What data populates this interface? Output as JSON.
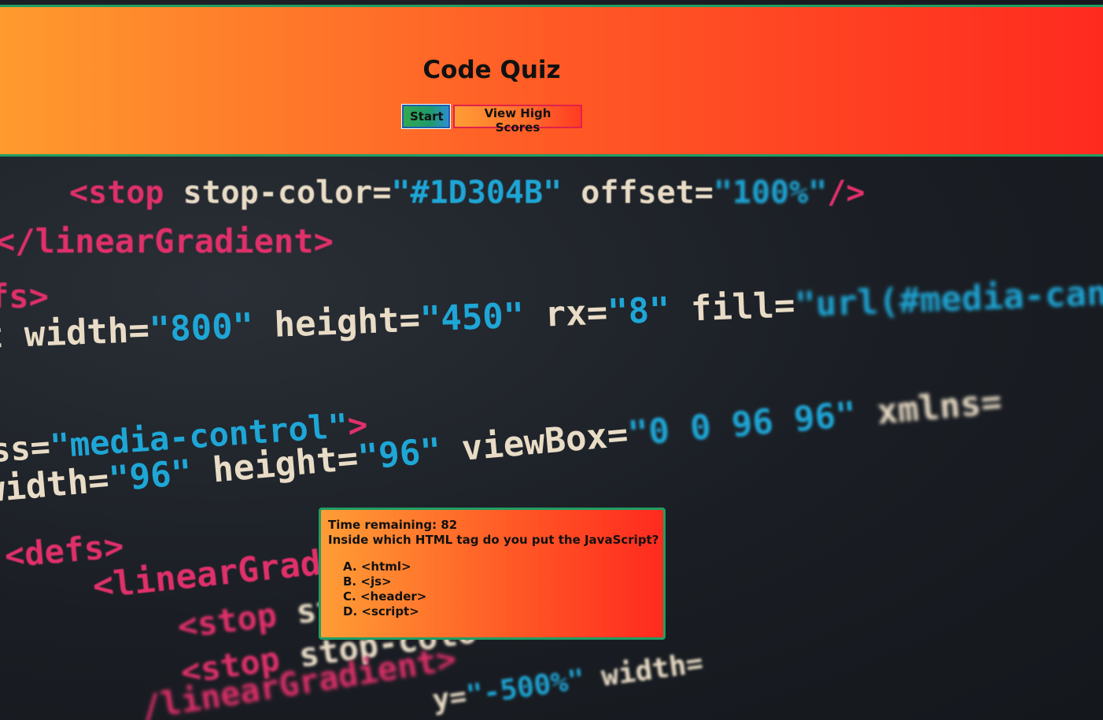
{
  "header": {
    "title": "Code Quiz",
    "start_label": "Start",
    "scores_label": "View High Scores"
  },
  "quiz": {
    "timer_label": "Time remaining:",
    "timer_value": "82",
    "question": "Inside which HTML tag do you put the JavaScript?",
    "answers": [
      {
        "letter": "A.",
        "text": "<html>"
      },
      {
        "letter": "B.",
        "text": "<js>"
      },
      {
        "letter": "C.",
        "text": "<header>"
      },
      {
        "letter": "D.",
        "text": "<script>"
      }
    ]
  },
  "background_code": {
    "line1": {
      "tag": "<stop",
      "attr1": " stop-color=",
      "val1": "\"#1D304B\"",
      "attr2": " offset=",
      "val2": "\"100%\"",
      "end": "/>"
    },
    "line2": {
      "tag": "</linearGradient>"
    },
    "line3": {
      "tag": "fs>"
    },
    "line4": {
      "attr1": "t width=",
      "val1": "\"800\"",
      "attr2": " height=",
      "val2": "\"450\"",
      "attr3": " rx=",
      "val3": "\"8\"",
      "attr4": " fill=",
      "val4": "\"url(#media-canvas)\""
    },
    "line5": {
      "attr1": "ss=",
      "val1": "\"media-control\"",
      "end": ">"
    },
    "line6": {
      "attr1": " width=",
      "val1": "\"96\"",
      "attr2": " height=",
      "val2": "\"96\"",
      "attr3": " viewBox=",
      "val3": "\"0 0 96 96\"",
      "attr4": " xmlns="
    },
    "line7": {
      "tag": "<defs>"
    },
    "line8": {
      "tag": "<linearGradi"
    },
    "line9": {
      "tag": "<stop",
      "attr1": " st"
    },
    "line10": {
      "tag": "<stop",
      "attr1": " stop-colo"
    },
    "line11": {
      "tag": "/linearGradient>"
    },
    "line12": {
      "attr1": "y=",
      "val1": "\"-500%\"",
      "attr2": " width="
    }
  },
  "colors": {
    "header_left": "#ff9a2e",
    "header_right": "#ff2a1f",
    "border_green": "#1f9e63",
    "tag_pink": "#e0306a",
    "value_blue": "#1ea6d6",
    "attr_cream": "#e9dcc6"
  }
}
